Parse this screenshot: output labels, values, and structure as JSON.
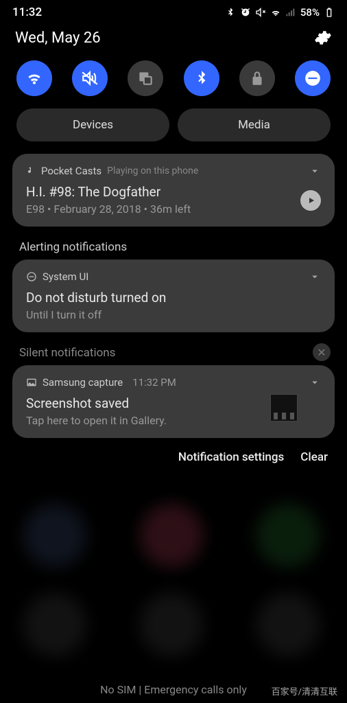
{
  "status": {
    "time": "11:32",
    "battery": "58%"
  },
  "header": {
    "date": "Wed, May 26"
  },
  "quick_settings": [
    {
      "name": "wifi",
      "on": true
    },
    {
      "name": "vibrate",
      "on": true
    },
    {
      "name": "multi-window",
      "on": false
    },
    {
      "name": "bluetooth",
      "on": true
    },
    {
      "name": "lock",
      "on": false
    },
    {
      "name": "dnd",
      "on": true
    }
  ],
  "wide_buttons": {
    "devices": "Devices",
    "media": "Media"
  },
  "media_card": {
    "app": "Pocket Casts",
    "status": "Playing on this phone",
    "title": "H.I. #98: The Dogfather",
    "subtitle": "E98 • February 28, 2018 • 36m left"
  },
  "sections": {
    "alerting": "Alerting notifications",
    "silent": "Silent notifications"
  },
  "dnd_card": {
    "app": "System UI",
    "title": "Do not disturb turned on",
    "subtitle": "Until I turn it off"
  },
  "capture_card": {
    "app": "Samsung capture",
    "time": "11:32 PM",
    "title": "Screenshot saved",
    "subtitle": "Tap here to open it in Gallery."
  },
  "bottom": {
    "settings": "Notification settings",
    "clear": "Clear"
  },
  "footer": "No SIM | Emergency calls only",
  "watermark": "百家号/清清互联"
}
